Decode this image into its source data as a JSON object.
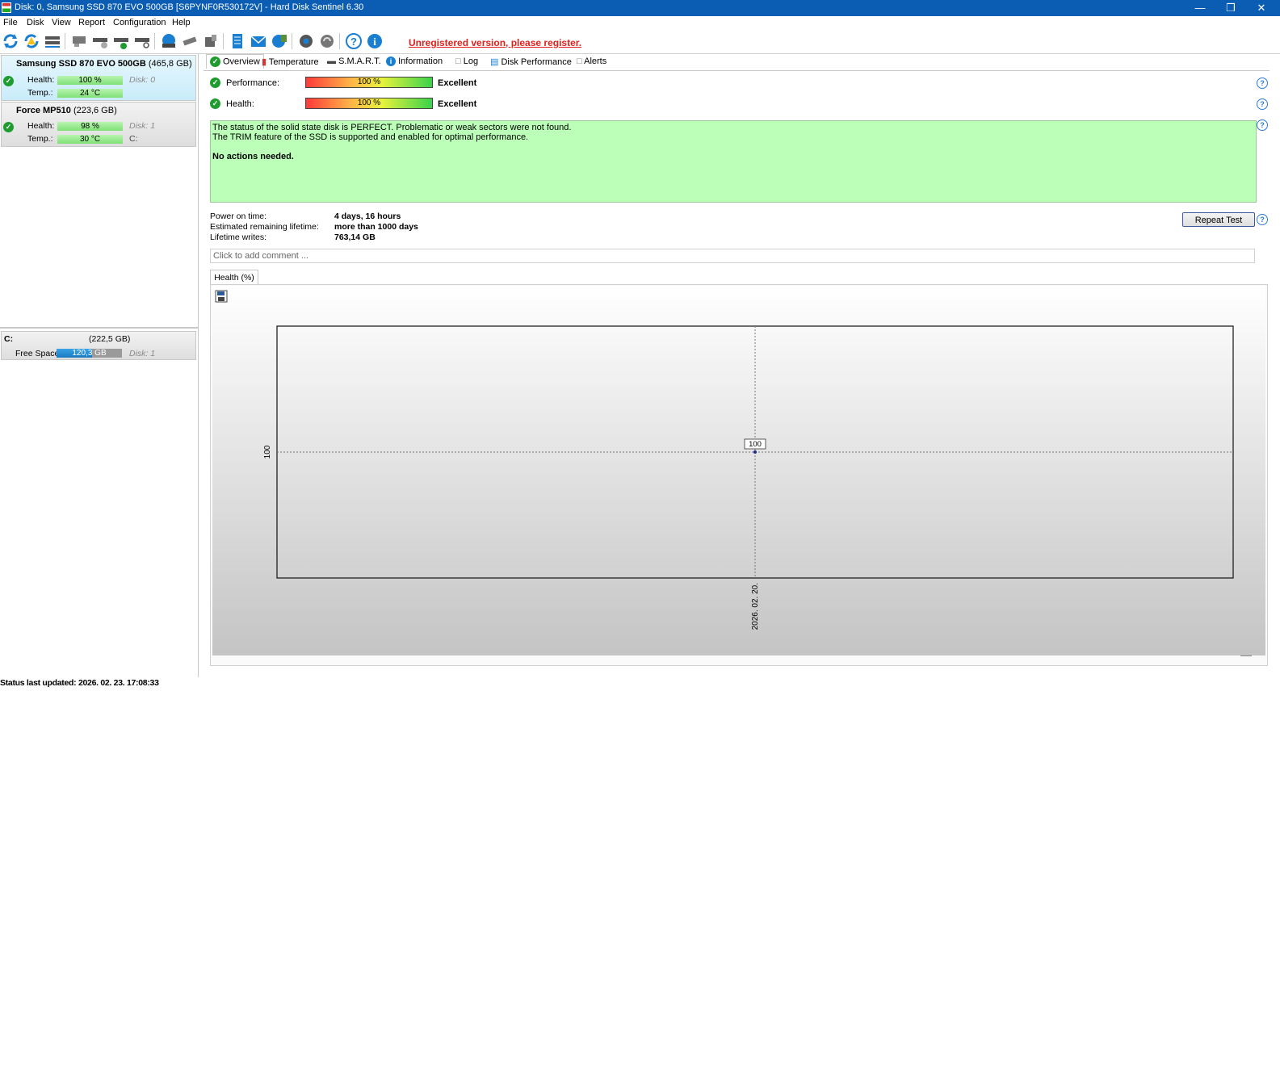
{
  "window": {
    "title": "Disk: 0, Samsung SSD 870 EVO 500GB [S6PYNF0R530172V]  -  Hard Disk Sentinel 6.30"
  },
  "menu": [
    "File",
    "Disk",
    "View",
    "Report",
    "Configuration",
    "Help"
  ],
  "toolbar": {
    "register_text": "Unregistered version, please register."
  },
  "disks": [
    {
      "name": "Samsung SSD 870 EVO 500GB",
      "size": "(465,8 GB)",
      "health_label": "Health:",
      "health": "100 %",
      "health_level": 1.0,
      "temp_label": "Temp.:",
      "temp": "24 °C",
      "disk_id": "Disk: 0",
      "selected": true
    },
    {
      "name": "Force MP510",
      "size": "(223,6 GB)",
      "health_label": "Health:",
      "health": "98 %",
      "health_level": 0.98,
      "temp_label": "Temp.:",
      "temp": "30 °C",
      "disk_id": "Disk: 1",
      "volume": "C:",
      "selected": false
    }
  ],
  "volume": {
    "name": "C:",
    "size": "(222,5 GB)",
    "free_label": "Free Space",
    "free": "120,3 GB",
    "free_level": 0.54,
    "disk_id": "Disk: 1"
  },
  "tabs": [
    "Overview",
    "Temperature",
    "S.M.A.R.T.",
    "Information",
    "Log",
    "Disk Performance",
    "Alerts"
  ],
  "overview": {
    "performance_label": "Performance:",
    "performance_value": "100 %",
    "performance_rating": "Excellent",
    "health_label": "Health:",
    "health_value": "100 %",
    "health_rating": "Excellent",
    "status_line1": "The status of the solid state disk is PERFECT. Problematic or weak sectors were not found.",
    "status_line2": "The TRIM feature of the SSD is supported and enabled for optimal performance.",
    "status_action": "No actions needed.",
    "power_on_label": "Power on time:",
    "power_on_value": "4 days, 16 hours",
    "lifetime_label": "Estimated remaining lifetime:",
    "lifetime_value": "more than 1000 days",
    "writes_label": "Lifetime writes:",
    "writes_value": "763,14 GB",
    "repeat_button": "Repeat Test",
    "comment_placeholder": "Click to add comment ..."
  },
  "chart_tab": "Health (%)",
  "chart_data": {
    "type": "line",
    "title": "Health (%)",
    "x": [
      "2026. 02. 20."
    ],
    "series": [
      {
        "values": [
          100
        ]
      }
    ],
    "ytick": "100",
    "xtick": "2026. 02. 20.",
    "point_label": "100"
  },
  "status_bar": "Status last updated: 2026. 02. 23. 17:08:33",
  "colors": {
    "title_bar": "#0a5db3",
    "status_box": "#bbffb8",
    "register_red": "#e0201b",
    "selected_disk": "#dff3fc"
  }
}
